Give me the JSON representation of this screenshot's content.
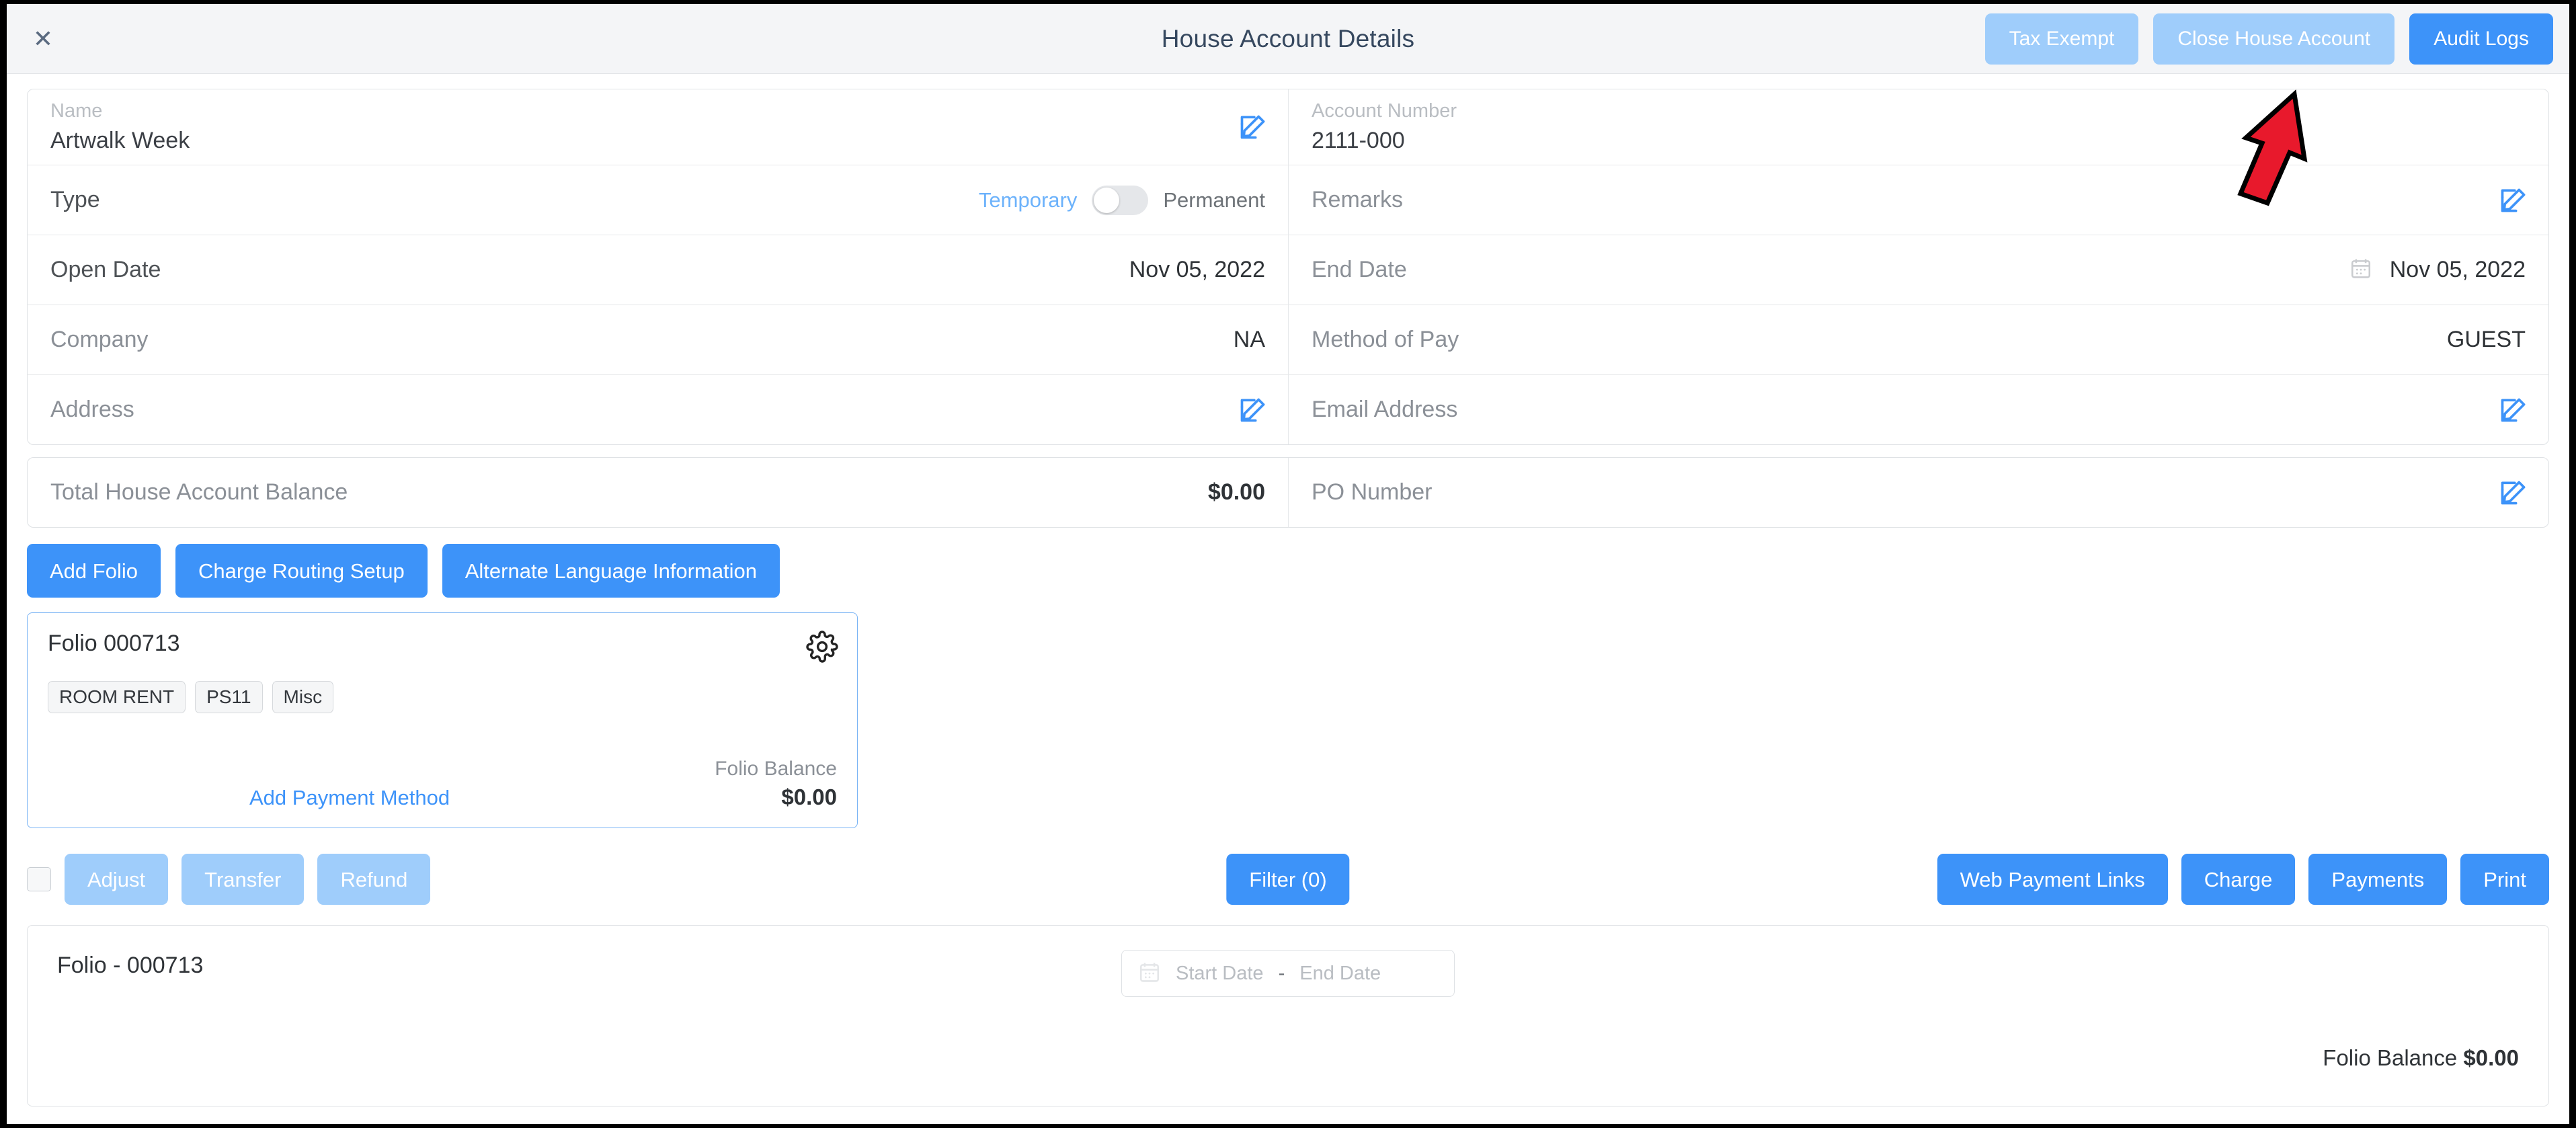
{
  "header": {
    "close_icon": "close-icon",
    "title": "House Account Details",
    "actions": [
      {
        "label": "Tax Exempt",
        "style": "muted"
      },
      {
        "label": "Close House Account",
        "style": "muted"
      },
      {
        "label": "Audit Logs",
        "style": "primary"
      }
    ]
  },
  "form": {
    "name": {
      "label": "Name",
      "value": "Artwalk Week",
      "edit_icon": "edit-icon"
    },
    "account_number": {
      "label": "Account Number",
      "value": "2111-000"
    },
    "type": {
      "label": "Type",
      "option_left": "Temporary",
      "option_right": "Permanent",
      "selected": "Temporary",
      "toggle_on": false
    },
    "remarks": {
      "label": "Remarks",
      "value": "",
      "edit_icon": "edit-icon"
    },
    "open_date": {
      "label": "Open Date",
      "value": "Nov 05, 2022"
    },
    "end_date": {
      "label": "End Date",
      "value": "Nov 05, 2022",
      "calendar_icon": "calendar-icon"
    },
    "company": {
      "label": "Company",
      "value": "NA"
    },
    "method_of_pay": {
      "label": "Method of Pay",
      "value": "GUEST"
    },
    "address": {
      "label": "Address",
      "value": "",
      "edit_icon": "edit-icon"
    },
    "email_address": {
      "label": "Email Address",
      "value": "",
      "edit_icon": "edit-icon"
    },
    "total_balance": {
      "label": "Total House Account Balance",
      "value": "$0.00"
    },
    "po_number": {
      "label": "PO Number",
      "value": "",
      "edit_icon": "edit-icon"
    }
  },
  "action_buttons": [
    {
      "label": "Add Folio"
    },
    {
      "label": "Charge Routing Setup"
    },
    {
      "label": "Alternate Language Information"
    }
  ],
  "folio_card": {
    "title": "Folio 000713",
    "gear_icon": "gear-icon",
    "chips": [
      "ROOM RENT",
      "PS11",
      "Misc"
    ],
    "add_payment_method": "Add Payment Method",
    "balance_label": "Folio Balance",
    "balance_value": "$0.00"
  },
  "toolbar": {
    "select_all_checkbox": "select-all-checkbox",
    "left_buttons": [
      {
        "label": "Adjust",
        "style": "muted"
      },
      {
        "label": "Transfer",
        "style": "muted"
      },
      {
        "label": "Refund",
        "style": "muted"
      }
    ],
    "filter": {
      "label": "Filter (0)",
      "style": "primary"
    },
    "right_buttons": [
      {
        "label": "Web Payment Links",
        "style": "primary"
      },
      {
        "label": "Charge",
        "style": "primary"
      },
      {
        "label": "Payments",
        "style": "primary"
      },
      {
        "label": "Print",
        "style": "primary"
      }
    ]
  },
  "bottom_panel": {
    "title": "Folio - 000713",
    "date_range": {
      "calendar_icon": "calendar-icon",
      "start_placeholder": "Start Date",
      "separator": "-",
      "end_placeholder": "End Date"
    },
    "balance_label": "Folio Balance",
    "balance_value": "$0.00"
  },
  "annotation": {
    "arrow_icon": "red-arrow-annotation",
    "color": "#e8192c"
  },
  "colors": {
    "accent": "#3d93f9",
    "accent_muted": "#9fcdfb",
    "header_bg": "#f4f5f7",
    "title_text": "#36485f",
    "label_grey": "#b9bdc2"
  }
}
